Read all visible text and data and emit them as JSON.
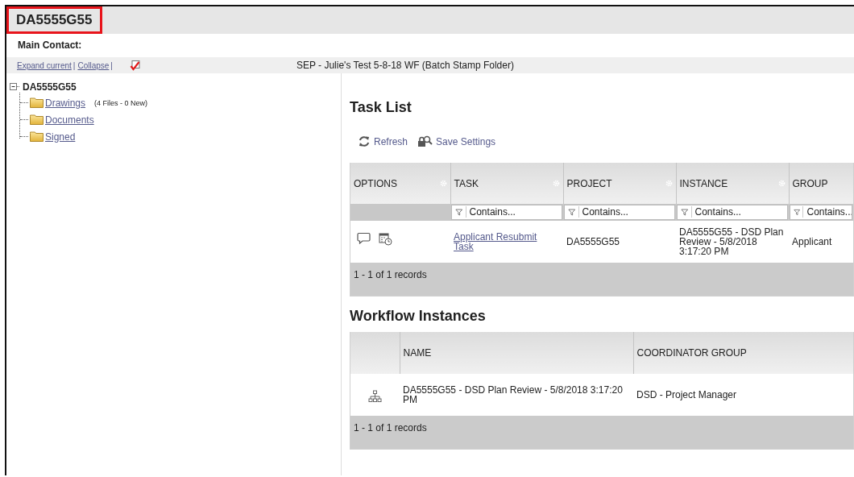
{
  "header": {
    "title": "DA5555G55",
    "highlighted": true
  },
  "main_contact": {
    "label": "Main Contact:"
  },
  "toolbar": {
    "links": [
      {
        "label": "Expand current",
        "separator": "|"
      },
      {
        "label": "Collapse",
        "separator": "|"
      }
    ],
    "stamp_checked": true,
    "folder_title": "SEP - Julie's Test 5-8-18 WF (Batch Stamp Folder)"
  },
  "tree": {
    "label": "DA5555G55",
    "expanded": true,
    "children": [
      {
        "label": "Drawings",
        "note": "(4 Files - 0 New)"
      },
      {
        "label": "Documents"
      },
      {
        "label": "Signed"
      }
    ]
  },
  "task_list": {
    "title": "Task List",
    "actions": [
      {
        "kind": "refresh",
        "label": "Refresh"
      },
      {
        "kind": "save",
        "label": "Save Settings"
      }
    ],
    "columns": [
      {
        "label": "OPTIONS",
        "menu": true
      },
      {
        "label": "TASK",
        "menu": true,
        "filter_placeholder": "Contains..."
      },
      {
        "label": "PROJECT",
        "menu": true,
        "filter_placeholder": "Contains..."
      },
      {
        "label": "INSTANCE",
        "menu": true,
        "filter_placeholder": "Contains..."
      },
      {
        "label": "GROUP",
        "menu": false,
        "filter_placeholder": "Contains..."
      }
    ],
    "rows": [
      {
        "cells": [
          {
            "kind": "options"
          },
          {
            "kind": "link",
            "text": "Applicant Resubmit Task"
          },
          {
            "kind": "text",
            "text": "DA5555G55"
          },
          {
            "kind": "text",
            "text": "DA5555G55 - DSD Plan Review - 5/8/2018 3:17:20 PM"
          },
          {
            "kind": "text",
            "text": "Applicant"
          }
        ]
      }
    ],
    "footer": "1 - 1 of 1 records"
  },
  "workflow": {
    "title": "Workflow Instances",
    "columns": [
      {
        "kind": "blank"
      },
      {
        "kind": "text",
        "label": "NAME"
      },
      {
        "kind": "text",
        "label": "COORDINATOR GROUP"
      }
    ],
    "rows": [
      {
        "cells": [
          {
            "kind": "hierarchy"
          },
          {
            "kind": "text",
            "text": "DA5555G55 - DSD Plan Review - 5/8/2018 3:17:20 PM"
          },
          {
            "kind": "text",
            "text": "DSD - Project Manager"
          }
        ]
      }
    ],
    "footer": "1 - 1 of 1 records"
  }
}
